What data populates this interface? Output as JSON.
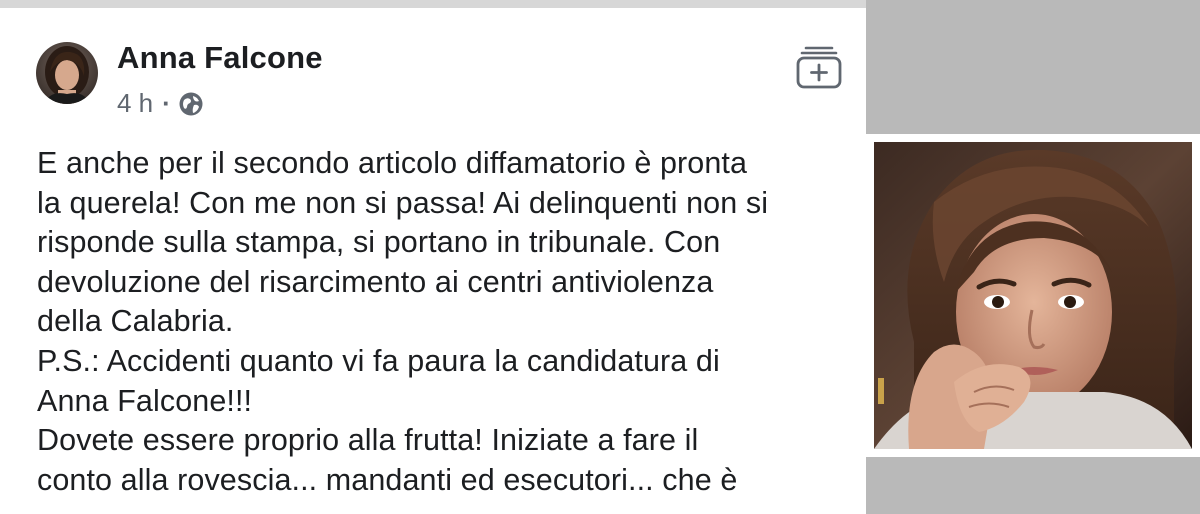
{
  "post": {
    "author_name": "Anna Falcone",
    "timestamp": "4 h",
    "separator": "·",
    "audience_icon": "globe-icon",
    "save_icon": "save-collection-icon",
    "lines": [
      "E anche per il secondo articolo diffamatorio è pronta",
      "la querela! Con me non si passa! Ai delinquenti non si",
      "risponde sulla stampa, si portano in tribunale. Con",
      "devoluzione del risarcimento ai centri antiviolenza",
      "della Calabria.",
      "P.S.: Accidenti quanto vi fa paura la candidatura di",
      "Anna Falcone!!!",
      "Dovete essere proprio alla frutta! Iniziate a fare il",
      "conto alla rovescia... mandanti ed esecutori... che è"
    ]
  },
  "photo": {
    "subject": "portrait of a woman with hands clasped near chin"
  },
  "colors": {
    "text_primary": "#1c1e21",
    "text_secondary": "#606770",
    "background_gray": "#b9b9b9",
    "card_white": "#ffffff"
  }
}
